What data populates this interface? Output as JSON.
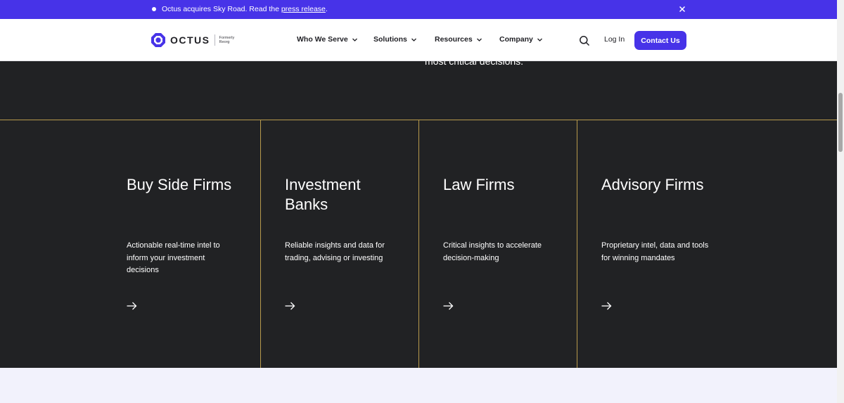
{
  "banner": {
    "text": "Octus acquires Sky Road. Read the ",
    "link": "press release",
    "suffix": "."
  },
  "brand": {
    "name": "OCTUS",
    "formerly_line1": "Formerly",
    "formerly_line2": "Reorg",
    "accent": "#4733e8"
  },
  "nav": {
    "items": [
      {
        "label": "Who We Serve"
      },
      {
        "label": "Solutions"
      },
      {
        "label": "Resources"
      },
      {
        "label": "Company"
      }
    ],
    "login": "Log In",
    "contact": "Contact Us"
  },
  "hero": {
    "cut_text": "most critical decisions."
  },
  "cards": [
    {
      "title": "Buy Side Firms",
      "description": "Actionable real-time intel to inform your investment decisions"
    },
    {
      "title": "Investment Banks",
      "description": "Reliable insights and data for trading, advising or investing"
    },
    {
      "title": "Law Firms",
      "description": "Critical insights to accelerate decision-making"
    },
    {
      "title": "Advisory Firms",
      "description": "Proprietary intel, data and tools for winning mandates"
    }
  ],
  "icons": {
    "banner_dot": "dot-icon",
    "close": "close-icon",
    "search": "search-icon",
    "chevron": "chevron-down-icon",
    "arrow": "arrow-right-icon"
  },
  "colors": {
    "dark_bg": "#212224",
    "gold_line": "#b89a4c",
    "light_bg": "#f2f2fc"
  }
}
